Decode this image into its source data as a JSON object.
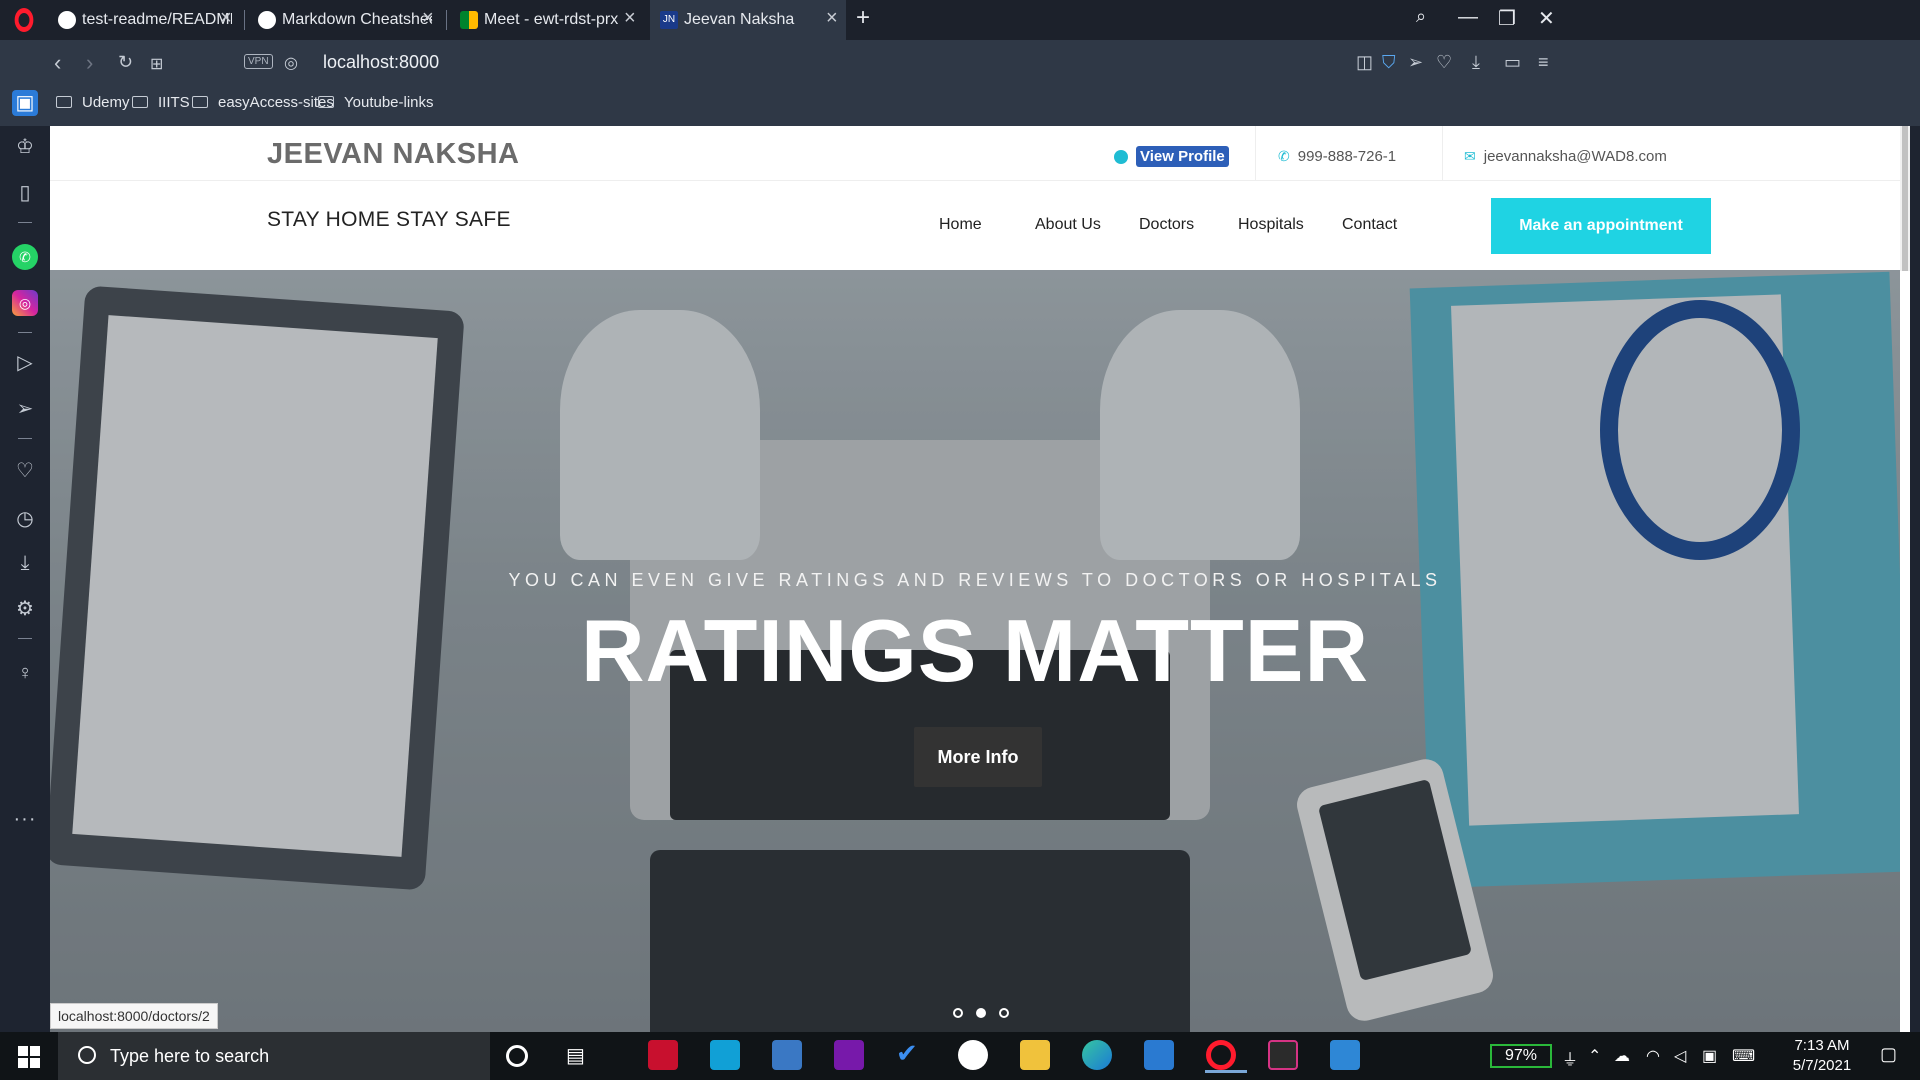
{
  "browser": {
    "tabs": [
      {
        "title": "test-readme/README.md a",
        "favicon": "github-icon"
      },
      {
        "title": "Markdown Cheatsheet · ad",
        "favicon": "github-icon"
      },
      {
        "title": "Meet - ewt-rdst-prx",
        "favicon": "google-meet-icon"
      },
      {
        "title": "Jeevan Naksha",
        "favicon": "jn-icon",
        "active": true
      }
    ],
    "url": "localhost:8000",
    "vpn_label": "VPN",
    "bookmarks": [
      "Udemy",
      "IIITS",
      "easyAccess-sites",
      "Youtube-links"
    ],
    "status_url": "localhost:8000/doctors/2"
  },
  "site": {
    "brand": "JEEVAN NAKSHA",
    "view_profile": "View Profile",
    "phone": "999-888-726-1",
    "email": "jeevannaksha@WAD8.com",
    "tagline": "STAY HOME STAY SAFE",
    "nav": [
      "Home",
      "About Us",
      "Doctors",
      "Hospitals",
      "Contact"
    ],
    "cta": "Make an appointment",
    "hero": {
      "subtitle": "YOU CAN EVEN GIVE RATINGS AND REVIEWS TO DOCTORS OR HOSPITALS",
      "title": "RATINGS MATTER",
      "button": "More Info",
      "active_slide": 2,
      "slide_count": 3
    },
    "colors": {
      "accent": "#1fd3e3",
      "profile_button": "#2d5fb8"
    }
  },
  "taskbar": {
    "search_placeholder": "Type here to search",
    "battery": "97%",
    "time": "7:13 AM",
    "date": "5/7/2021"
  }
}
